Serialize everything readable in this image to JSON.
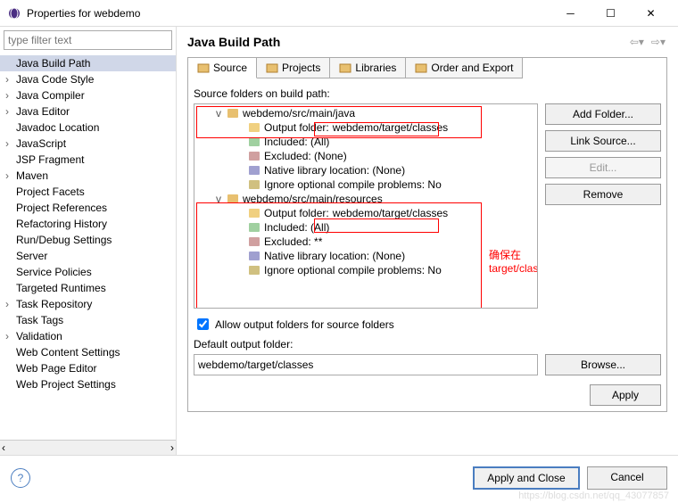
{
  "window": {
    "title": "Properties for webdemo"
  },
  "sidebar": {
    "filter_placeholder": "type filter text",
    "items": [
      {
        "label": "Java Build Path",
        "arrow": false,
        "selected": true
      },
      {
        "label": "Java Code Style",
        "arrow": true
      },
      {
        "label": "Java Compiler",
        "arrow": true
      },
      {
        "label": "Java Editor",
        "arrow": true
      },
      {
        "label": "Javadoc Location",
        "arrow": false
      },
      {
        "label": "JavaScript",
        "arrow": true
      },
      {
        "label": "JSP Fragment",
        "arrow": false
      },
      {
        "label": "Maven",
        "arrow": true
      },
      {
        "label": "Project Facets",
        "arrow": false
      },
      {
        "label": "Project References",
        "arrow": false
      },
      {
        "label": "Refactoring History",
        "arrow": false
      },
      {
        "label": "Run/Debug Settings",
        "arrow": false
      },
      {
        "label": "Server",
        "arrow": false
      },
      {
        "label": "Service Policies",
        "arrow": false
      },
      {
        "label": "Targeted Runtimes",
        "arrow": false
      },
      {
        "label": "Task Repository",
        "arrow": true
      },
      {
        "label": "Task Tags",
        "arrow": false
      },
      {
        "label": "Validation",
        "arrow": true
      },
      {
        "label": "Web Content Settings",
        "arrow": false
      },
      {
        "label": "Web Page Editor",
        "arrow": false
      },
      {
        "label": "Web Project Settings",
        "arrow": false
      }
    ]
  },
  "content": {
    "title": "Java Build Path",
    "tabs": [
      {
        "label": "Source",
        "icon": "folder-icon"
      },
      {
        "label": "Projects",
        "icon": "project-icon"
      },
      {
        "label": "Libraries",
        "icon": "library-icon"
      },
      {
        "label": "Order and Export",
        "icon": "order-icon"
      }
    ],
    "build_label": "Source folders on build path:",
    "tree": [
      {
        "type": "folder",
        "label": "webdemo/src/main/java",
        "indent": 1,
        "caret": "v"
      },
      {
        "type": "output",
        "label_prefix": "Output folder: ",
        "value": "webdemo/target/classes",
        "indent": 2
      },
      {
        "type": "included",
        "label": "Included: (All)",
        "indent": 2
      },
      {
        "type": "excluded",
        "label": "Excluded: (None)",
        "indent": 2
      },
      {
        "type": "native",
        "label": "Native library location: (None)",
        "indent": 2
      },
      {
        "type": "ignore",
        "label": "Ignore optional compile problems: No",
        "indent": 2
      },
      {
        "type": "folder",
        "label": "webdemo/src/main/resources",
        "indent": 1,
        "caret": "v"
      },
      {
        "type": "output",
        "label_prefix": "Output folder: ",
        "value": "webdemo/target/classes",
        "indent": 2
      },
      {
        "type": "included",
        "label": "Included: (All)",
        "indent": 2
      },
      {
        "type": "excluded",
        "label": "Excluded: **",
        "indent": 2
      },
      {
        "type": "native",
        "label": "Native library location: (None)",
        "indent": 2
      },
      {
        "type": "ignore",
        "label": "Ignore optional compile problems: No",
        "indent": 2
      }
    ],
    "buttons": {
      "add_folder": "Add Folder...",
      "link_source": "Link Source...",
      "edit": "Edit...",
      "remove": "Remove",
      "browse": "Browse...",
      "apply": "Apply"
    },
    "allow_output": "Allow output folders for source folders",
    "default_output_label": "Default output folder:",
    "default_output_value": "webdemo/target/classes",
    "annotation": "确保在target/classes"
  },
  "footer": {
    "apply_close": "Apply and Close",
    "cancel": "Cancel"
  },
  "watermark": "https://blog.csdn.net/qq_43077857"
}
